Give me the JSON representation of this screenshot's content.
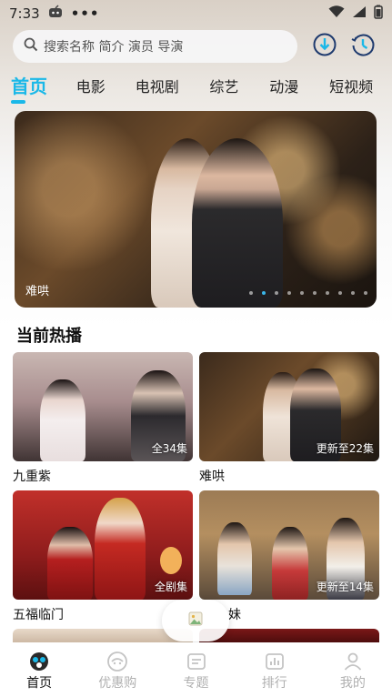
{
  "status_bar": {
    "time": "7:33",
    "dots": "•••"
  },
  "search": {
    "placeholder": "搜索名称 简介 演员 导演"
  },
  "tabs": [
    {
      "label": "首页",
      "active": true
    },
    {
      "label": "电影"
    },
    {
      "label": "电视剧"
    },
    {
      "label": "综艺"
    },
    {
      "label": "动漫"
    },
    {
      "label": "短视频"
    }
  ],
  "banner": {
    "title": "难哄",
    "active_index": 1,
    "dot_count": 10
  },
  "section": {
    "title": "当前热播"
  },
  "cards": [
    {
      "title": "九重紫",
      "episodes": "全34集"
    },
    {
      "title": "难哄",
      "episodes": "更新至22集"
    },
    {
      "title": "五福临门",
      "episodes": "全剧集"
    },
    {
      "title": "妹",
      "episodes": "更新至14集"
    }
  ],
  "bottom_nav": [
    {
      "label": "首页",
      "icon": "home-icon",
      "active": true
    },
    {
      "label": "优惠购",
      "icon": "coupon-icon"
    },
    {
      "label": "专题",
      "icon": "topic-icon"
    },
    {
      "label": "排行",
      "icon": "ranking-icon"
    },
    {
      "label": "我的",
      "icon": "profile-icon"
    }
  ],
  "colors": {
    "accent": "#1ab8e8",
    "inactive": "#b0b0b0"
  }
}
